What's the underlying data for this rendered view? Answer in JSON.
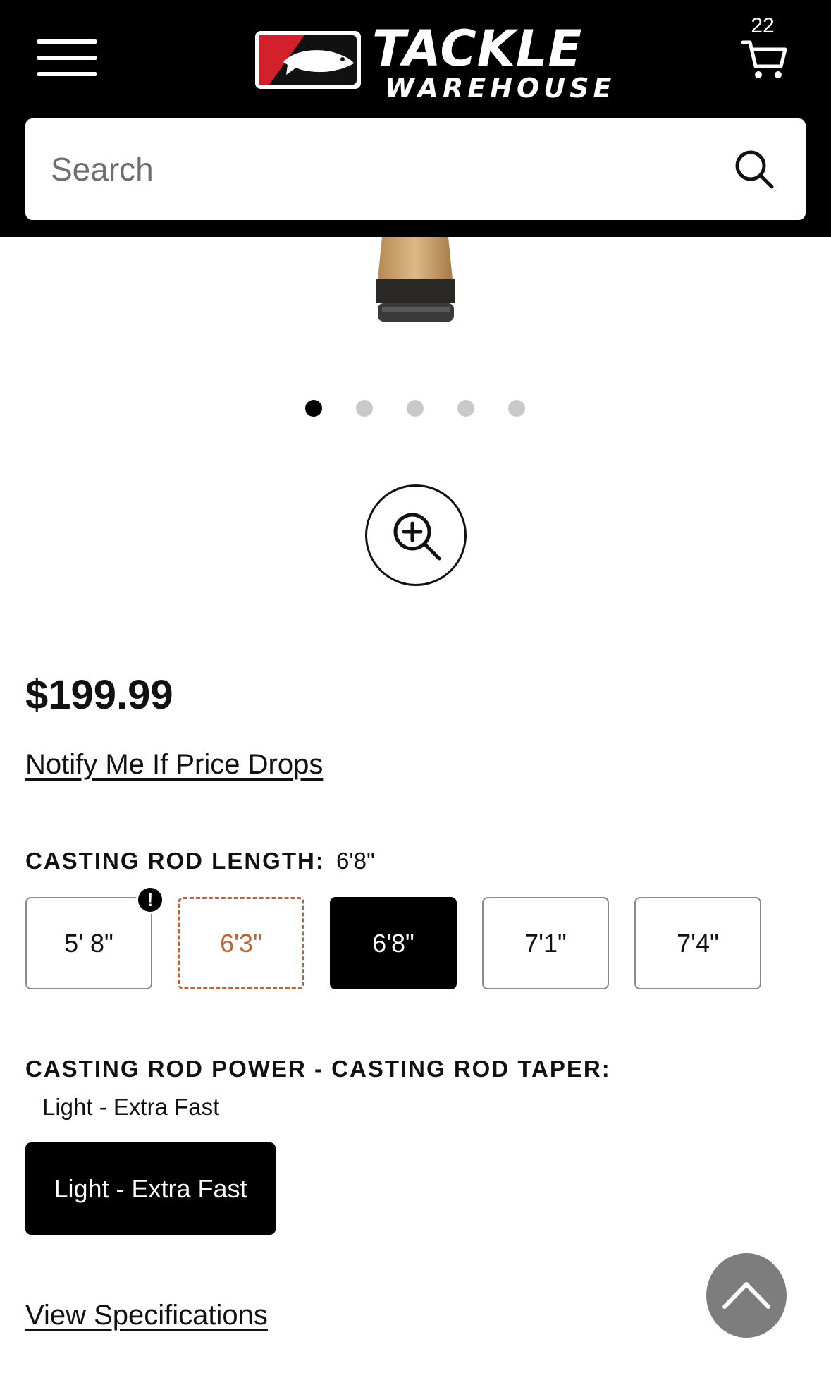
{
  "header": {
    "logo": {
      "line1": "TACKLE",
      "line2": "WAREHOUSE"
    },
    "cart_count": "22",
    "search": {
      "placeholder": "Search",
      "value": ""
    }
  },
  "gallery": {
    "dots": 5,
    "active_index": 0
  },
  "product": {
    "price": "$199.99",
    "notify_link": "Notify Me If Price Drops"
  },
  "options": {
    "length": {
      "label": "CASTING ROD LENGTH:",
      "selected": "6'8\"",
      "values": [
        "5' 8\"",
        "6'3\"",
        "6'8\"",
        "7'1\"",
        "7'4\""
      ],
      "states": [
        "warning",
        "unavailable",
        "selected",
        "available",
        "available"
      ]
    },
    "power_taper": {
      "label": "CASTING ROD POWER - CASTING ROD TAPER:",
      "selected": "Light - Extra Fast",
      "values": [
        "Light - Extra Fast"
      ]
    }
  },
  "links": {
    "view_specs": "View Specifications"
  },
  "colors": {
    "header_bg": "#000000",
    "unavailable": "#b8643a",
    "back_to_top": "#7d7d7d"
  }
}
